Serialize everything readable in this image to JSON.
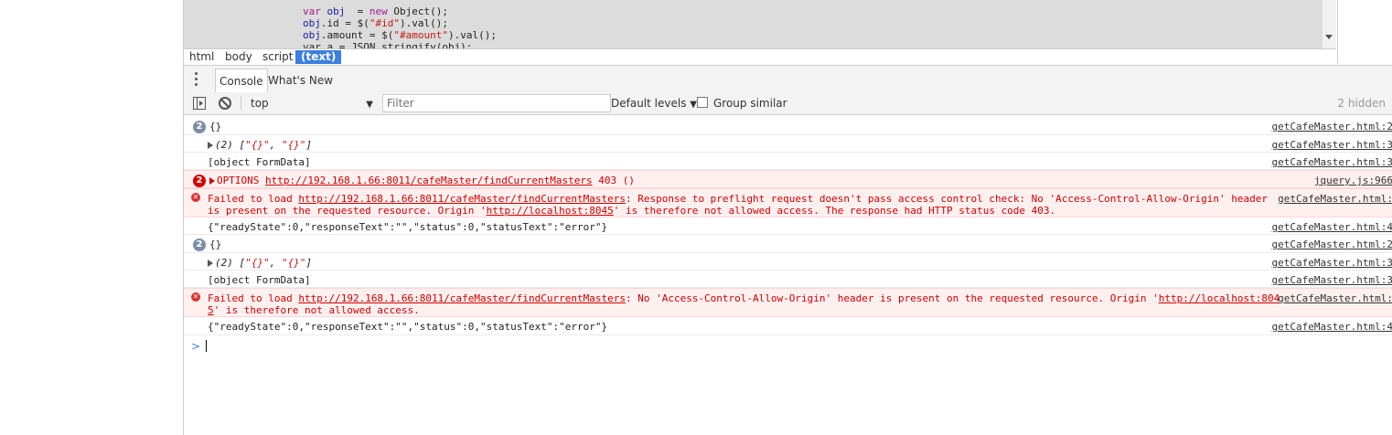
{
  "source": {
    "lines": [
      {
        "parts": [
          {
            "t": "var ",
            "c": "kw"
          },
          {
            "t": "obj",
            "c": "prop"
          },
          {
            "t": "  = ",
            "c": ""
          },
          {
            "t": "new ",
            "c": "kw"
          },
          {
            "t": "Object();",
            "c": ""
          }
        ]
      },
      {
        "parts": [
          {
            "t": "obj",
            "c": "prop"
          },
          {
            "t": ".id = $(",
            "c": ""
          },
          {
            "t": "\"#id\"",
            "c": "str"
          },
          {
            "t": ").val();",
            "c": ""
          }
        ]
      },
      {
        "parts": [
          {
            "t": "obj",
            "c": "prop"
          },
          {
            "t": ".amount = $(",
            "c": ""
          },
          {
            "t": "\"#amount\"",
            "c": "str"
          },
          {
            "t": ").val();",
            "c": ""
          }
        ]
      },
      {
        "parts": [
          {
            "t": "var a = JSON.stringify(obj);",
            "c": ""
          }
        ]
      }
    ]
  },
  "breadcrumbs": [
    "html",
    "body",
    "script",
    "(text)"
  ],
  "drawer": {
    "tabs": [
      "Console",
      "What's New"
    ]
  },
  "toolbar": {
    "context": "top",
    "filter_placeholder": "Filter",
    "levels": "Default levels",
    "group_similar": "Group similar",
    "hidden": "2 hidden"
  },
  "messages": [
    {
      "type": "log",
      "badge": "2",
      "text": "{}",
      "src": "getCafeMaster.html:2"
    },
    {
      "type": "array",
      "text": "(2) [",
      "s1": "\"{}\"",
      "mid": ", ",
      "s2": "\"{}\"",
      "end": "]",
      "src": "getCafeMaster.html:3"
    },
    {
      "type": "log",
      "text": "[object FormData]",
      "src": "getCafeMaster.html:3"
    },
    {
      "type": "neterr",
      "badge": "2",
      "method": "OPTIONS",
      "url": "http://192.168.1.66:8011/cafeMaster/findCurrentMasters",
      "status": "403 ()",
      "src": "jquery.js:966"
    },
    {
      "type": "error",
      "line1a": "Failed to load ",
      "url1": "http://192.168.1.66:8011/cafeMaster/findCurrentMasters",
      "line1b": ": Response to preflight request doesn't pass access control check: No 'Access-Control-Allow-Origin' header",
      "line2a": "is present on the requested resource. Origin '",
      "url2": "http://localhost:8045",
      "line2b": "' is therefore not allowed access. The response had HTTP status code 403.",
      "src": "getCafeMaster.html:"
    },
    {
      "type": "log",
      "text": "{\"readyState\":0,\"responseText\":\"\",\"status\":0,\"statusText\":\"error\"}",
      "src": "getCafeMaster.html:4"
    },
    {
      "type": "log",
      "badge": "2",
      "text": "{}",
      "src": "getCafeMaster.html:2"
    },
    {
      "type": "array",
      "text": "(2) [",
      "s1": "\"{}\"",
      "mid": ", ",
      "s2": "\"{}\"",
      "end": "]",
      "src": "getCafeMaster.html:3"
    },
    {
      "type": "log",
      "text": "[object FormData]",
      "src": "getCafeMaster.html:3"
    },
    {
      "type": "error",
      "line1a": "Failed to load ",
      "url1": "http://192.168.1.66:8011/cafeMaster/findCurrentMasters",
      "line1b": ": No 'Access-Control-Allow-Origin' header is present on the requested resource. Origin '",
      "url2a": "http://localhost:804",
      "line2a": "",
      "url2": "5",
      "line2b": "' is therefore not allowed access.",
      "src": "getCafeMaster.html:"
    },
    {
      "type": "log",
      "text": "{\"readyState\":0,\"responseText\":\"\",\"status\":0,\"statusText\":\"error\"}",
      "src": "getCafeMaster.html:4"
    }
  ],
  "prompt": ">"
}
